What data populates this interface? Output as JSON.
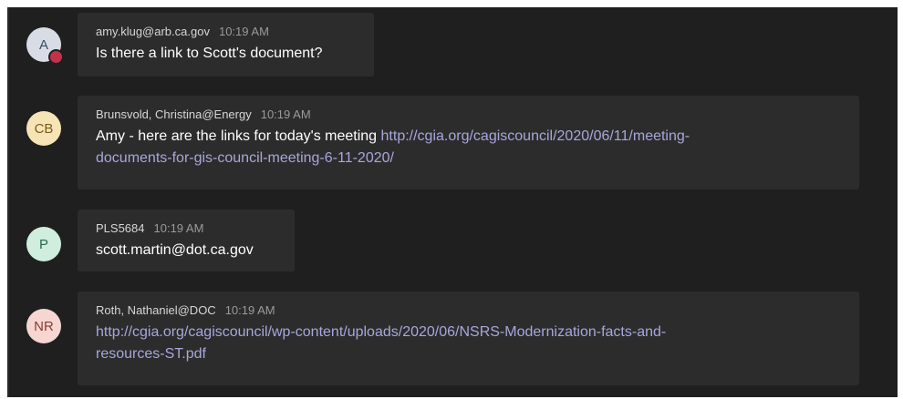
{
  "messages": [
    {
      "avatar": "A",
      "sender": "amy.klug@arb.ca.gov",
      "time": "10:19 AM",
      "text": "Is there a link to Scott's document?",
      "link_line1": "",
      "link_line2": ""
    },
    {
      "avatar": "CB",
      "sender": "Brunsvold, Christina@Energy",
      "time": "10:19 AM",
      "text": "Amy - here are the links for today's meeting ",
      "link_line1": "http://cgia.org/cagiscouncil/2020/06/11/meeting-",
      "link_line2": "documents-for-gis-council-meeting-6-11-2020/"
    },
    {
      "avatar": "P",
      "sender": "PLS5684",
      "time": "10:19 AM",
      "text": "scott.martin@dot.ca.gov",
      "link_line1": "",
      "link_line2": ""
    },
    {
      "avatar": "NR",
      "sender": "Roth, Nathaniel@DOC",
      "time": "10:19 AM",
      "text": "",
      "link_line1": "http://cgia.org/cagiscouncil/wp-content/uploads/2020/06/NSRS-Modernization-facts-and-",
      "link_line2": "resources-ST.pdf"
    }
  ],
  "colors": {
    "background": "#1f1f1f",
    "bubble": "#2d2c2c",
    "link": "#a6a7dc",
    "avatar_a": "#d8dde5",
    "avatar_cb": "#f7e4b6",
    "avatar_p": "#cfeedd",
    "avatar_nr": "#f7d6d2",
    "status_busy": "#c4314b"
  }
}
